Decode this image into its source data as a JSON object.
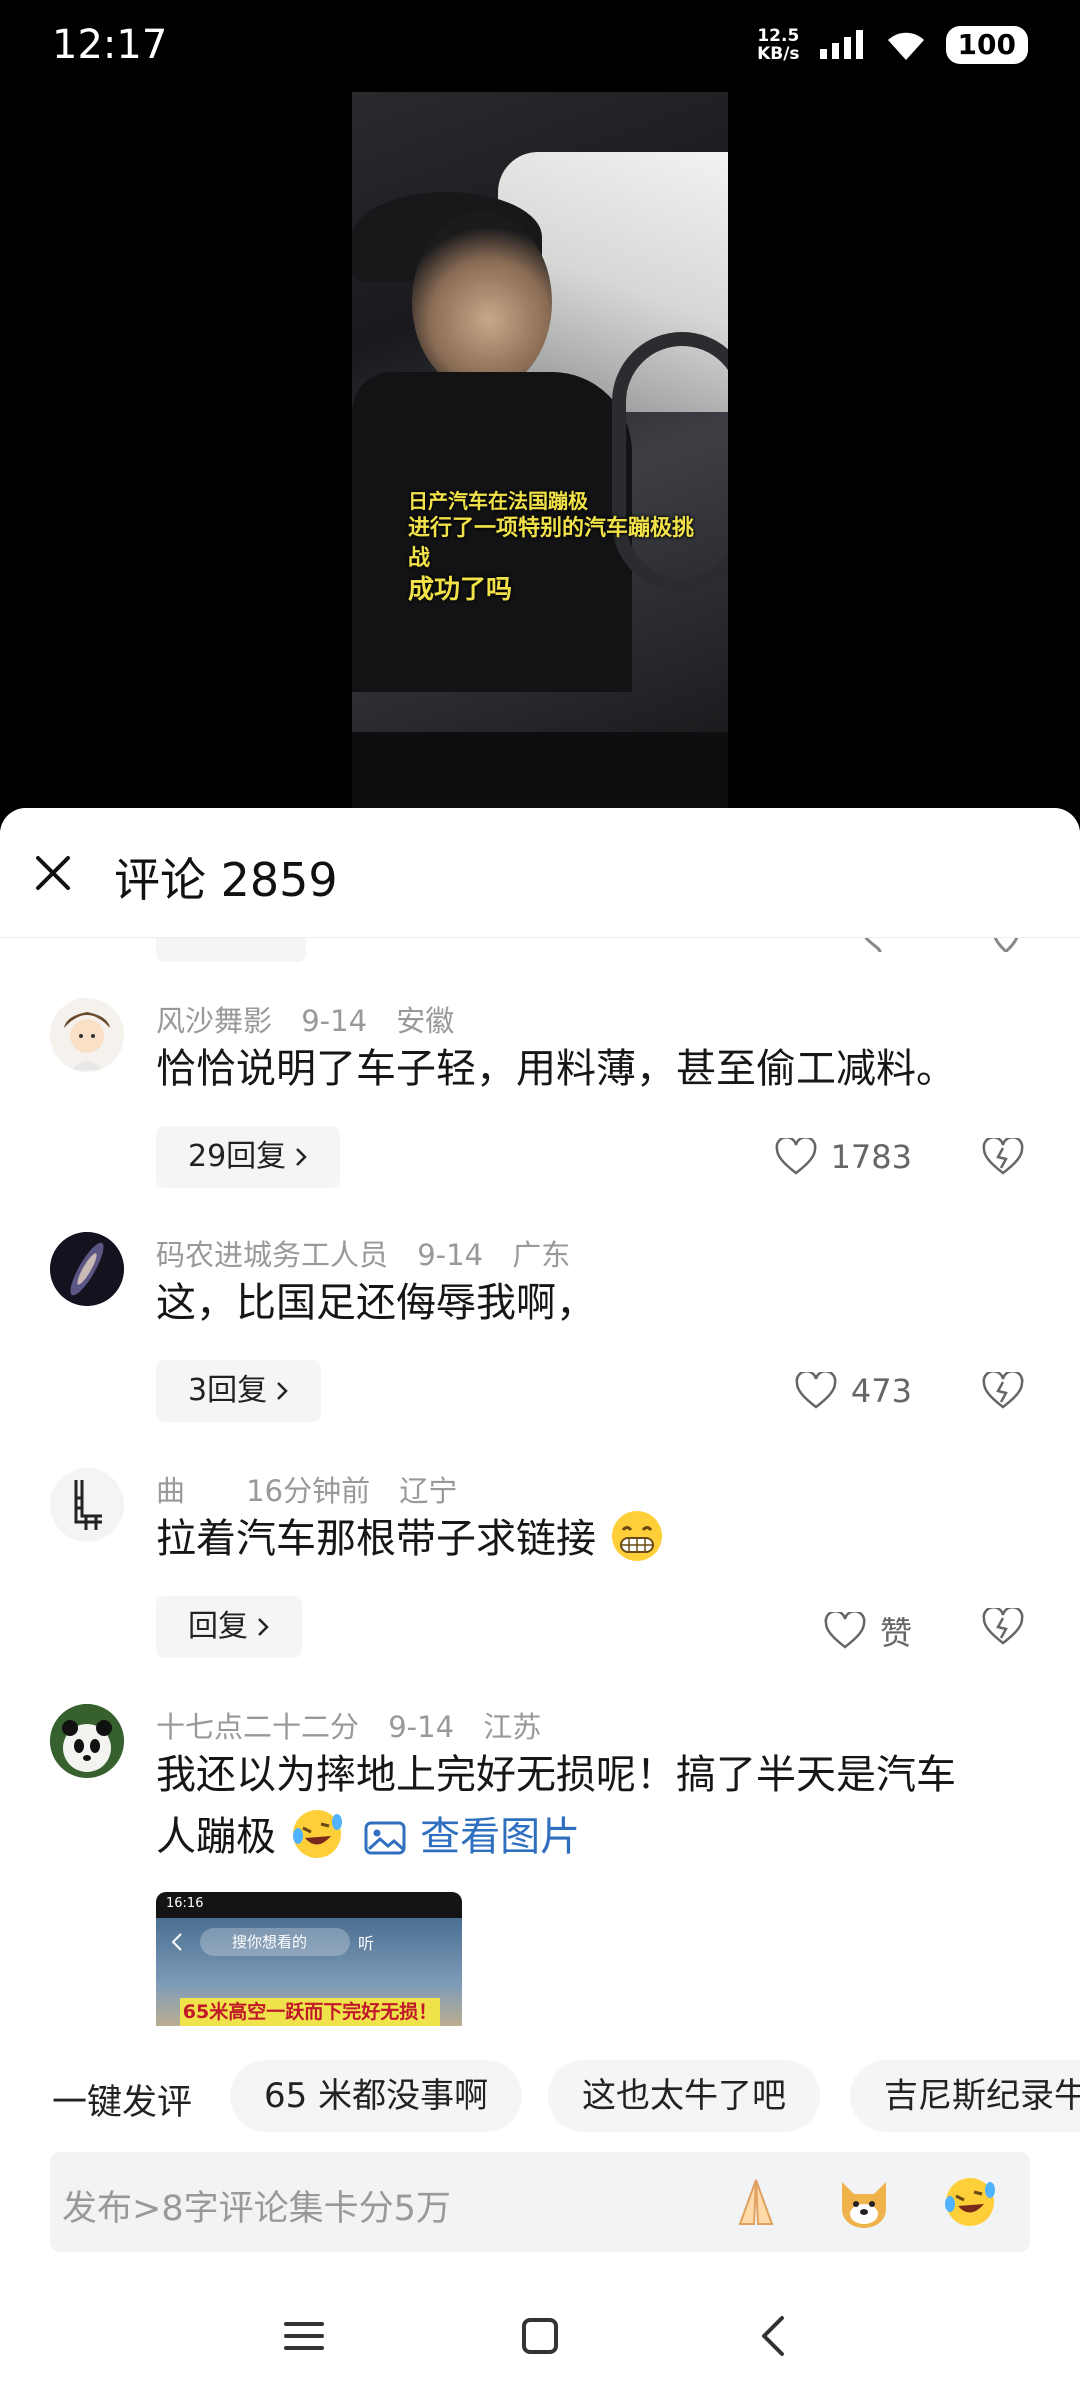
{
  "status_bar": {
    "time": "12:17",
    "net_speed_value": "12.5",
    "net_speed_unit": "KB/s",
    "battery": "100"
  },
  "video": {
    "caption_line1": "日产汽车在法国蹦极",
    "caption_line2": "进行了一项特别的汽车蹦极挑战",
    "caption_line3": "成功了吗"
  },
  "header": {
    "title": "评论 2859"
  },
  "comments": [
    {
      "user": "风沙舞影",
      "date": "9-14",
      "location": "安徽",
      "text": "恰恰说明了车子轻，用料薄，甚至偷工减料。",
      "reply_label": "29回复",
      "likes": "1783"
    },
    {
      "user": "码农进城务工人员",
      "date": "9-14",
      "location": "广东",
      "text": "这，比国足还侮辱我啊，",
      "reply_label": "3回复",
      "likes": "473"
    },
    {
      "user": "曲",
      "date": "16分钟前",
      "location": "辽宁",
      "text": "拉着汽车那根带子求链接",
      "reply_label": "回复",
      "likes": "赞"
    },
    {
      "user": "十七点二十二分",
      "date": "9-14",
      "location": "江苏",
      "text_line1": "我还以为摔地上完好无损呢！搞了半天是汽车",
      "text_line2": "人蹦极",
      "view_image": "查看图片",
      "thumb_time": "16:16",
      "thumb_search": "搜你想看的",
      "thumb_listen": "听",
      "thumb_caption": "65米高空一跃而下完好无损！"
    }
  ],
  "quick_comments": {
    "label": "一键发评",
    "chips": [
      "65 米都没事啊",
      "这也太牛了吧",
      "吉尼斯纪录牛"
    ]
  },
  "input": {
    "placeholder": "发布>8字评论集卡分5万",
    "emojis": [
      "folded-hands-emoji",
      "shiba-dog-emoji",
      "rofl-emoji"
    ]
  },
  "colors": {
    "link": "#2f6fbf",
    "chip_bg": "#f4f5f7"
  }
}
